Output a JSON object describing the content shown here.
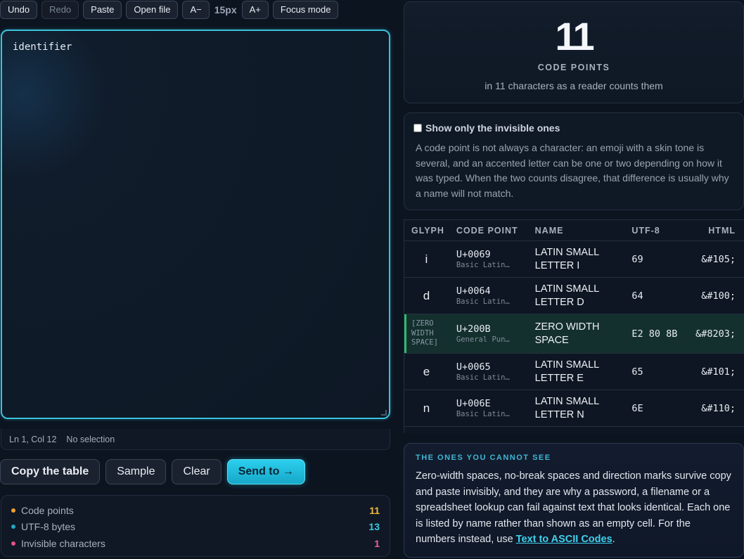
{
  "toolbar": {
    "undo": "Undo",
    "redo": "Redo",
    "paste": "Paste",
    "open_file": "Open file",
    "font_down": "A−",
    "font_size": "15px",
    "font_up": "A+",
    "focus_mode": "Focus mode"
  },
  "editor": {
    "value": "identifier"
  },
  "status": {
    "position": "Ln 1, Col 12",
    "selection": "No selection"
  },
  "actions": {
    "copy_table": "Copy the table",
    "sample": "Sample",
    "clear": "Clear",
    "send_to": "Send to →"
  },
  "stats": [
    {
      "label": "Code points",
      "value": "11",
      "color": "#f0a030",
      "value_color": "#f2b93a"
    },
    {
      "label": "UTF-8 bytes",
      "value": "13",
      "color": "#22a6c4",
      "value_color": "#3cc8e6"
    },
    {
      "label": "Invisible characters",
      "value": "1",
      "color": "#e8508a",
      "value_color": "#f06292"
    }
  ],
  "summary": {
    "count": "11",
    "label": "CODE POINTS",
    "sub": "in 11 characters as a reader counts them"
  },
  "info": {
    "checkbox_label": "Show only the invisible ones",
    "text": "A code point is not always a character: an emoji with a skin tone is several, and an accented letter can be one or two depending on how it was typed. When the two counts disagree, that difference is usually why a name will not match."
  },
  "table": {
    "headers": {
      "glyph": "GLYPH",
      "code_point": "CODE POINT",
      "name": "NAME",
      "utf8": "UTF-8",
      "html": "HTML"
    },
    "rows": [
      {
        "glyph": "i",
        "code": "U+0069",
        "block": "Basic Latin…",
        "name": "LATIN SMALL LETTER I",
        "utf8": "69",
        "html": "&#105;",
        "invisible": false
      },
      {
        "glyph": "d",
        "code": "U+0064",
        "block": "Basic Latin…",
        "name": "LATIN SMALL LETTER D",
        "utf8": "64",
        "html": "&#100;",
        "invisible": false
      },
      {
        "glyph": "[ZERO WIDTH SPACE]",
        "code": "U+200B",
        "block": "General Pun…",
        "name": "ZERO WIDTH SPACE",
        "utf8": "E2 80 8B",
        "html": "&#8203;",
        "invisible": true
      },
      {
        "glyph": "e",
        "code": "U+0065",
        "block": "Basic Latin…",
        "name": "LATIN SMALL LETTER E",
        "utf8": "65",
        "html": "&#101;",
        "invisible": false
      },
      {
        "glyph": "n",
        "code": "U+006E",
        "block": "Basic Latin…",
        "name": "LATIN SMALL LETTER N",
        "utf8": "6E",
        "html": "&#110;",
        "invisible": false
      }
    ]
  },
  "note": {
    "title": "THE ONES YOU CANNOT SEE",
    "body": "Zero-width spaces, no-break spaces and direction marks survive copy and paste invisibly, and they are why a password, a filename or a spreadsheet lookup can fail against text that looks identical. Each one is listed by name rather than shown as an empty cell. For the numbers instead, use ",
    "link": "Text to ASCII Codes",
    "end": "."
  }
}
